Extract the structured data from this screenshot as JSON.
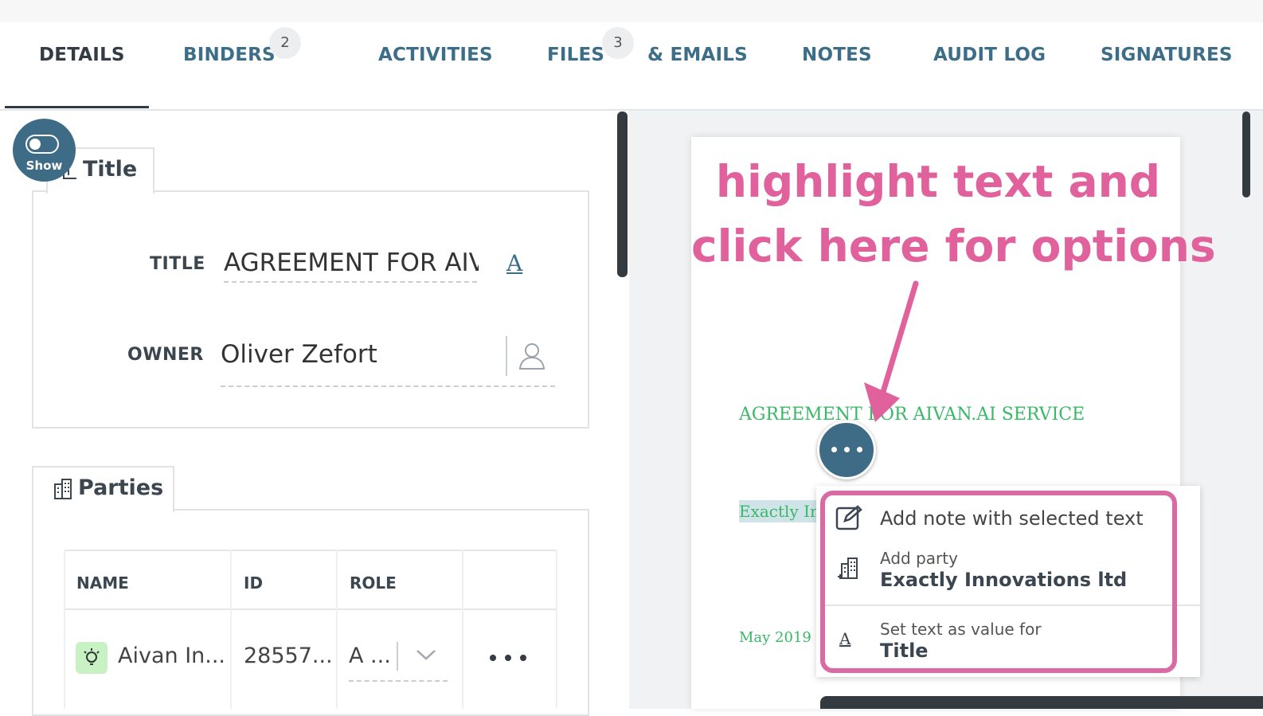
{
  "tabs": [
    {
      "label": "DETAILS",
      "active": true
    },
    {
      "label": "BINDERS",
      "count": "2"
    },
    {
      "label": "ACTIVITIES"
    },
    {
      "label": "FILES",
      "count": "3"
    },
    {
      "label": "& EMAILS"
    },
    {
      "label": "NOTES"
    },
    {
      "label": "AUDIT LOG"
    },
    {
      "label": "SIGNATURES"
    }
  ],
  "toggle": {
    "label": "Show",
    "state": "off"
  },
  "title_card": {
    "heading": "Title",
    "title_label": "TITLE",
    "title_value": "AGREEMENT FOR AIV",
    "title_action_glyph": "A",
    "owner_label": "OWNER",
    "owner_value": "Oliver Zefort"
  },
  "parties_card": {
    "heading": "Parties",
    "columns": [
      "NAME",
      "ID",
      "ROLE",
      ""
    ],
    "rows": [
      {
        "name": "Aivan In...",
        "id": "28557...",
        "role": "A ..."
      }
    ]
  },
  "annotation": {
    "line1": "highlight text and",
    "line2": "click here for options"
  },
  "document": {
    "heading": "AGREEMENT FOR AIVAN.AI SERVICE",
    "highlighted_text": "Exactly Innovations ltd",
    "date": "May 2019"
  },
  "context_menu": {
    "add_note": "Add note with selected text",
    "add_party_label": "Add party",
    "add_party_value": "Exactly Innovations ltd",
    "set_text_label": "Set text as value for",
    "set_text_value": "Title"
  },
  "colors": {
    "accent": "#3e6c86",
    "annotation": "#e0619b",
    "doc_text": "#39b866"
  }
}
